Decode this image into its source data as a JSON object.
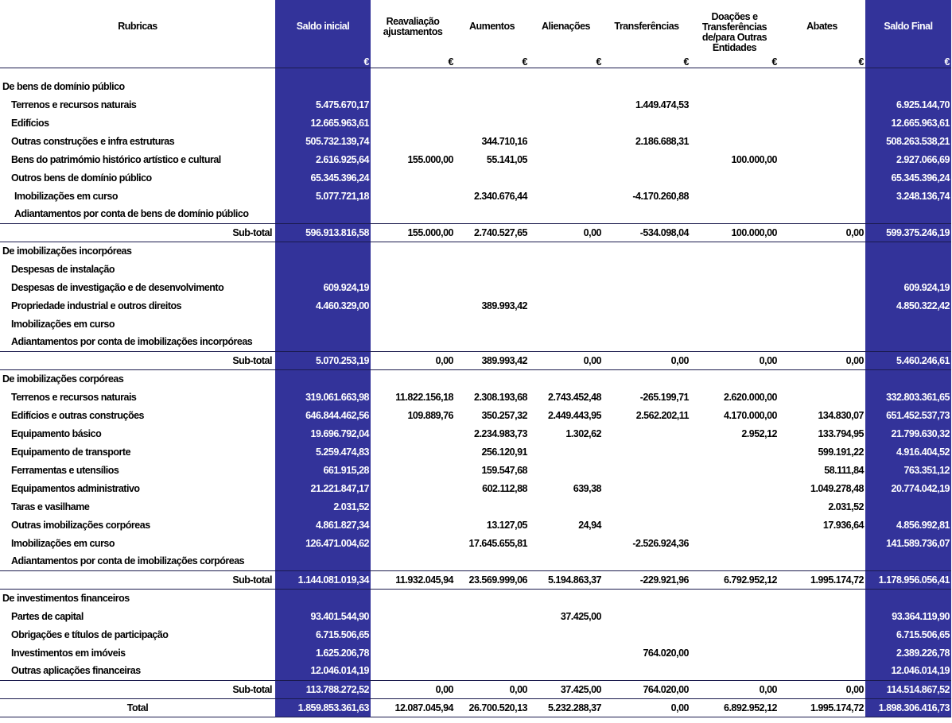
{
  "headers": {
    "rubricas": "Rubricas",
    "saldo_inicial": "Saldo inicial",
    "reavaliacao": "Reavaliação\najustamentos",
    "aumentos": "Aumentos",
    "alienacoes": "Alienações",
    "transferencias": "Transferências",
    "doacoes": "Doações e\nTransferências\nde/para Outras\nEntidades",
    "abates": "Abates",
    "saldo_final": "Saldo Final",
    "currency": "€"
  },
  "sections": [
    {
      "title": "De bens de domínio público",
      "rows": [
        {
          "label": "Terrenos e recursos naturais",
          "values": [
            "5.475.670,17",
            "",
            "",
            "",
            "1.449.474,53",
            "",
            "",
            "6.925.144,70"
          ]
        },
        {
          "label": "Edifícios",
          "values": [
            "12.665.963,61",
            "",
            "",
            "",
            "",
            "",
            "",
            "12.665.963,61"
          ]
        },
        {
          "label": "Outras construções e infra estruturas",
          "values": [
            "505.732.139,74",
            "",
            "344.710,16",
            "",
            "2.186.688,31",
            "",
            "",
            "508.263.538,21"
          ]
        },
        {
          "label": "Bens do patrimómio histórico artístico e cultural",
          "values": [
            "2.616.925,64",
            "155.000,00",
            "55.141,05",
            "",
            "",
            "100.000,00",
            "",
            "2.927.066,69"
          ]
        },
        {
          "label": "Outros bens de domínio público",
          "values": [
            "65.345.396,24",
            "",
            "",
            "",
            "",
            "",
            "",
            "65.345.396,24"
          ]
        },
        {
          "label": "Imobilizações em curso",
          "indent": true,
          "values": [
            "5.077.721,18",
            "",
            "2.340.676,44",
            "",
            "-4.170.260,88",
            "",
            "",
            "3.248.136,74"
          ]
        },
        {
          "label": "Adiantamentos por conta de bens de domínio público",
          "indent": true,
          "values": [
            "",
            "",
            "",
            "",
            "",
            "",
            "",
            ""
          ]
        }
      ],
      "subtotal": {
        "label": "Sub-total",
        "values": [
          "596.913.816,58",
          "155.000,00",
          "2.740.527,65",
          "0,00",
          "-534.098,04",
          "100.000,00",
          "0,00",
          "599.375.246,19"
        ]
      }
    },
    {
      "title": "De imobilizações incorpóreas",
      "rows": [
        {
          "label": "Despesas de instalação",
          "values": [
            "",
            "",
            "",
            "",
            "",
            "",
            "",
            ""
          ]
        },
        {
          "label": "Despesas de investigação e de desenvolvimento",
          "values": [
            "609.924,19",
            "",
            "",
            "",
            "",
            "",
            "",
            "609.924,19"
          ]
        },
        {
          "label": "Propriedade industrial e outros direitos",
          "values": [
            "4.460.329,00",
            "",
            "389.993,42",
            "",
            "",
            "",
            "",
            "4.850.322,42"
          ]
        },
        {
          "label": "Imobilizações em curso",
          "values": [
            "",
            "",
            "",
            "",
            "",
            "",
            "",
            ""
          ]
        },
        {
          "label": "Adiantamentos por conta de imobilizações incorpóreas",
          "values": [
            "",
            "",
            "",
            "",
            "",
            "",
            "",
            ""
          ]
        }
      ],
      "subtotal": {
        "label": "Sub-total",
        "values": [
          "5.070.253,19",
          "0,00",
          "389.993,42",
          "0,00",
          "0,00",
          "0,00",
          "0,00",
          "5.460.246,61"
        ]
      }
    },
    {
      "title": "De imobilizações corpóreas",
      "rows": [
        {
          "label": "Terrenos e recursos naturais",
          "values": [
            "319.061.663,98",
            "11.822.156,18",
            "2.308.193,68",
            "2.743.452,48",
            "-265.199,71",
            "2.620.000,00",
            "",
            "332.803.361,65"
          ]
        },
        {
          "label": "Edifícios e outras construções",
          "values": [
            "646.844.462,56",
            "109.889,76",
            "350.257,32",
            "2.449.443,95",
            "2.562.202,11",
            "4.170.000,00",
            "134.830,07",
            "651.452.537,73"
          ]
        },
        {
          "label": "Equipamento básico",
          "values": [
            "19.696.792,04",
            "",
            "2.234.983,73",
            "1.302,62",
            "",
            "2.952,12",
            "133.794,95",
            "21.799.630,32"
          ]
        },
        {
          "label": "Equipamento de transporte",
          "values": [
            "5.259.474,83",
            "",
            "256.120,91",
            "",
            "",
            "",
            "599.191,22",
            "4.916.404,52"
          ]
        },
        {
          "label": "Ferramentas e utensílios",
          "values": [
            "661.915,28",
            "",
            "159.547,68",
            "",
            "",
            "",
            "58.111,84",
            "763.351,12"
          ]
        },
        {
          "label": "Equipamentos administrativo",
          "values": [
            "21.221.847,17",
            "",
            "602.112,88",
            "639,38",
            "",
            "",
            "1.049.278,48",
            "20.774.042,19"
          ]
        },
        {
          "label": "Taras e vasilhame",
          "values": [
            "2.031,52",
            "",
            "",
            "",
            "",
            "",
            "2.031,52",
            ""
          ]
        },
        {
          "label": "Outras imobilizações corpóreas",
          "values": [
            "4.861.827,34",
            "",
            "13.127,05",
            "24,94",
            "",
            "",
            "17.936,64",
            "4.856.992,81"
          ]
        },
        {
          "label": "Imobilizações em curso",
          "values": [
            "126.471.004,62",
            "",
            "17.645.655,81",
            "",
            "-2.526.924,36",
            "",
            "",
            "141.589.736,07"
          ]
        },
        {
          "label": "Adiantamentos por conta de imobilizações corpóreas",
          "values": [
            "",
            "",
            "",
            "",
            "",
            "",
            "",
            ""
          ]
        }
      ],
      "subtotal": {
        "label": "Sub-total",
        "values": [
          "1.144.081.019,34",
          "11.932.045,94",
          "23.569.999,06",
          "5.194.863,37",
          "-229.921,96",
          "6.792.952,12",
          "1.995.174,72",
          "1.178.956.056,41"
        ]
      }
    },
    {
      "title": "De investimentos financeiros",
      "rows": [
        {
          "label": "Partes de capital",
          "values": [
            "93.401.544,90",
            "",
            "",
            "37.425,00",
            "",
            "",
            "",
            "93.364.119,90"
          ]
        },
        {
          "label": "Obrigações e títulos de participação",
          "values": [
            "6.715.506,65",
            "",
            "",
            "",
            "",
            "",
            "",
            "6.715.506,65"
          ]
        },
        {
          "label": "Investimentos em imóveis",
          "values": [
            "1.625.206,78",
            "",
            "",
            "",
            "764.020,00",
            "",
            "",
            "2.389.226,78"
          ]
        },
        {
          "label": "Outras aplicações financeiras",
          "values": [
            "12.046.014,19",
            "",
            "",
            "",
            "",
            "",
            "",
            "12.046.014,19"
          ]
        }
      ],
      "subtotal": {
        "label": "Sub-total",
        "values": [
          "113.788.272,52",
          "0,00",
          "0,00",
          "37.425,00",
          "764.020,00",
          "0,00",
          "0,00",
          "114.514.867,52"
        ]
      }
    }
  ],
  "total": {
    "label": "Total",
    "values": [
      "1.859.853.361,63",
      "12.087.045,94",
      "26.700.520,13",
      "5.232.288,37",
      "0,00",
      "6.892.952,12",
      "1.995.174,72",
      "1.898.306.416,73"
    ]
  },
  "colors": {
    "accent": "#33339a",
    "rule": "#1a1a4d"
  }
}
